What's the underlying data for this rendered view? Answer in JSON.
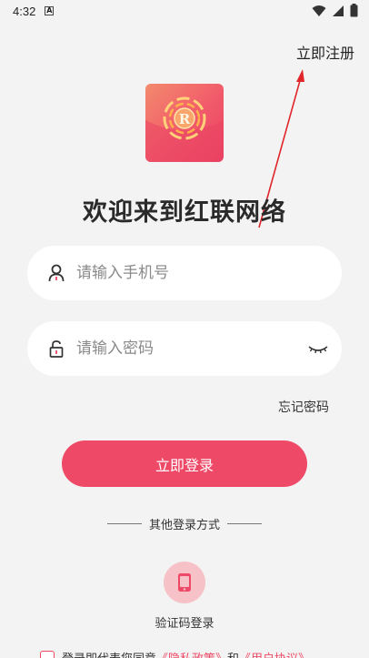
{
  "status_bar": {
    "time": "4:32",
    "notification_letter": "A"
  },
  "header": {
    "register_label": "立即注册"
  },
  "logo": {
    "letter": "R"
  },
  "welcome_title": "欢迎来到红联网络",
  "form": {
    "phone_placeholder": "请输入手机号",
    "password_placeholder": "请输入密码",
    "forgot_label": "忘记密码",
    "login_label": "立即登录"
  },
  "other_login": {
    "title": "其他登录方式",
    "sms_label": "验证码登录"
  },
  "agreement": {
    "prefix": "登录即代表您同意",
    "privacy_label": "《隐私政策》",
    "and_label": "和",
    "terms_label": "《用户协议》"
  },
  "colors": {
    "accent": "#ee4a68",
    "background": "#f3f3f3",
    "sms_circle": "#f6c2c7"
  }
}
